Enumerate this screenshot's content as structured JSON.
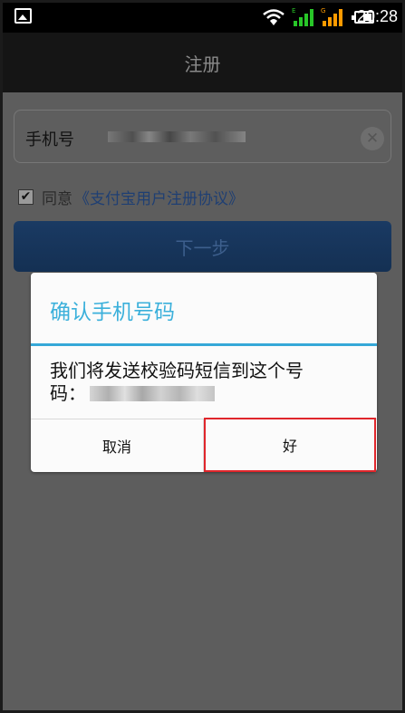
{
  "status_bar": {
    "time": "20:28",
    "icons": [
      "gallery-icon",
      "wifi-icon",
      "signal-icon",
      "signal-icon",
      "battery-icon"
    ]
  },
  "title_bar": {
    "title": "注册"
  },
  "form": {
    "phone_label": "手机号",
    "agree_prefix": "同意",
    "agreement_link": "《支付宝用户注册协议》",
    "next_label": "下一步"
  },
  "dialog": {
    "title": "确认手机号码",
    "message_line1": "我们将发送校验码短信到这个号",
    "message_line2": "码：",
    "cancel_label": "取消",
    "ok_label": "好"
  },
  "colors": {
    "dialog_accent": "#35a8d8",
    "highlight_border": "#e0262b",
    "signal_green": "#28c628",
    "signal_orange": "#ff9b00"
  }
}
